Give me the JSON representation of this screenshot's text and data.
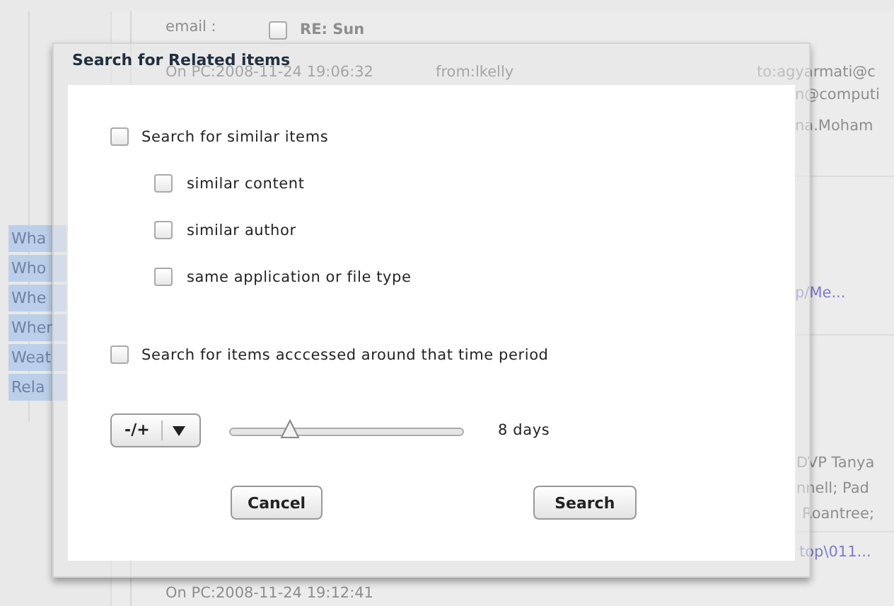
{
  "background": {
    "email_label": "email :",
    "subject_checked": false,
    "subject": "RE: Sun",
    "sent": "On PC:2008-11-24 19:06:32",
    "from": "from:lkelly",
    "to": "to:agyarmati@c",
    "recipients": [
      "n@computi",
      "na.Moham"
    ],
    "tabs": [
      "Wha",
      "Who",
      "Whe",
      "Wher",
      "Weat",
      "Rela"
    ],
    "link_1": "p/Me...",
    "names": [
      "DVP Tanya",
      "nnell; Pad",
      "Roantree;"
    ],
    "link_2": "top\\011...",
    "sent_2": "On PC:2008-11-24 19:12:41"
  },
  "dialog": {
    "title": "Search for Related items",
    "options": [
      {
        "kind": "main",
        "label": "Search for similar items",
        "checked": false
      },
      {
        "kind": "sub",
        "label": "similar content",
        "checked": false
      },
      {
        "kind": "sub",
        "label": "similar author",
        "checked": false
      },
      {
        "kind": "sub",
        "label": "same application or file type",
        "checked": false
      },
      {
        "kind": "main",
        "label": "Search for items acccessed around that time period",
        "checked": false
      }
    ],
    "period": {
      "stepper": "-/+",
      "level": 0.26,
      "reading": "8 days"
    },
    "buttons": [
      "Cancel",
      "Search"
    ]
  }
}
